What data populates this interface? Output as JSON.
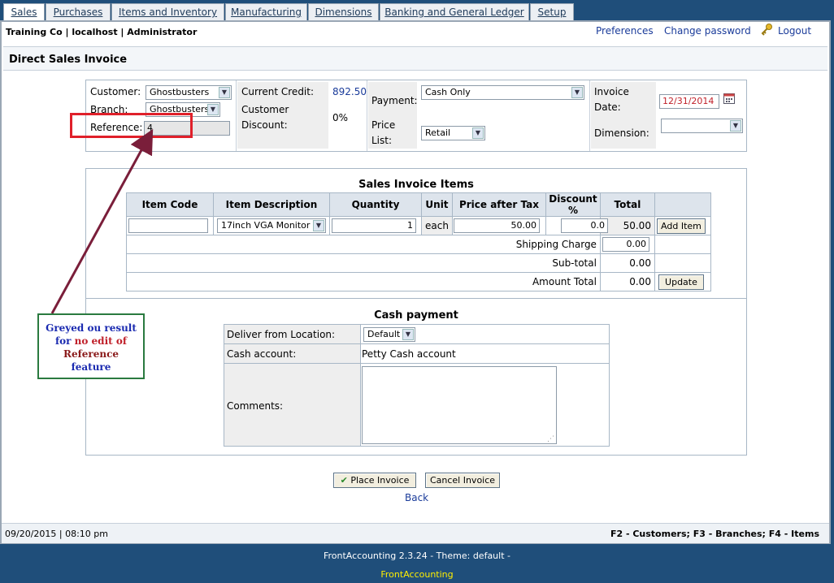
{
  "tabs": [
    "Sales",
    "Purchases",
    "Items and Inventory",
    "Manufacturing",
    "Dimensions",
    "Banking and General Ledger",
    "Setup"
  ],
  "header": {
    "company": "Training Co | localhost | Administrator",
    "preferences": "Preferences",
    "change_password": "Change password",
    "logout": "Logout"
  },
  "page_title": "Direct Sales Invoice",
  "form": {
    "customer_label": "Customer:",
    "customer_value": "Ghostbusters",
    "branch_label": "Branch:",
    "branch_value": "Ghostbusters",
    "reference_label": "Reference:",
    "reference_value": "4",
    "current_credit_label": "Current Credit:",
    "current_credit_value": "892.50",
    "customer_discount_label1": "Customer",
    "customer_discount_label2": "Discount:",
    "customer_discount_value": "0%",
    "payment_label": "Payment:",
    "payment_value": "Cash Only",
    "price_list_label1": "Price",
    "price_list_label2": "List:",
    "price_list_value": "Retail",
    "invoice_date_label1": "Invoice",
    "invoice_date_label2": "Date:",
    "invoice_date_value": "12/31/2014",
    "dimension_label": "Dimension:",
    "dimension_value": ""
  },
  "items": {
    "title": "Sales Invoice Items",
    "headers": [
      "Item Code",
      "Item Description",
      "Quantity",
      "Unit",
      "Price after Tax",
      "Discount %",
      "Total"
    ],
    "row": {
      "item_code": "",
      "description": "17inch VGA Monitor",
      "quantity": "1",
      "unit": "each",
      "price": "50.00",
      "discount": "0.0",
      "total": "50.00",
      "add_label": "Add Item"
    },
    "shipping_label": "Shipping Charge",
    "shipping_value": "0.00",
    "subtotal_label": "Sub-total",
    "subtotal_value": "0.00",
    "amount_total_label": "Amount Total",
    "amount_total_value": "0.00",
    "update_label": "Update"
  },
  "cash": {
    "title": "Cash payment",
    "deliver_label": "Deliver from Location:",
    "deliver_value": "Default",
    "account_label": "Cash account:",
    "account_value": "Petty Cash account",
    "comments_label": "Comments:"
  },
  "actions": {
    "place": "Place Invoice",
    "cancel": "Cancel Invoice",
    "back": "Back"
  },
  "annotation": {
    "line1": "Greyed ou result",
    "line2a": "for ",
    "line2b": "no edit of",
    "line3": "Reference",
    "line4": "feature"
  },
  "status": {
    "datetime": "09/20/2015 | 08:10 pm",
    "shortcuts": "F2 - Customers; F3 - Branches; F4 - Items"
  },
  "footer": {
    "version": "FrontAccounting 2.3.24 - Theme: default -",
    "link": "FrontAccounting"
  },
  "colors": {
    "page_bg": "#1f4e7a",
    "highlight_red": "#e0202a",
    "arrow": "#7a1e3a",
    "annotation_border": "#2a7a3f"
  }
}
